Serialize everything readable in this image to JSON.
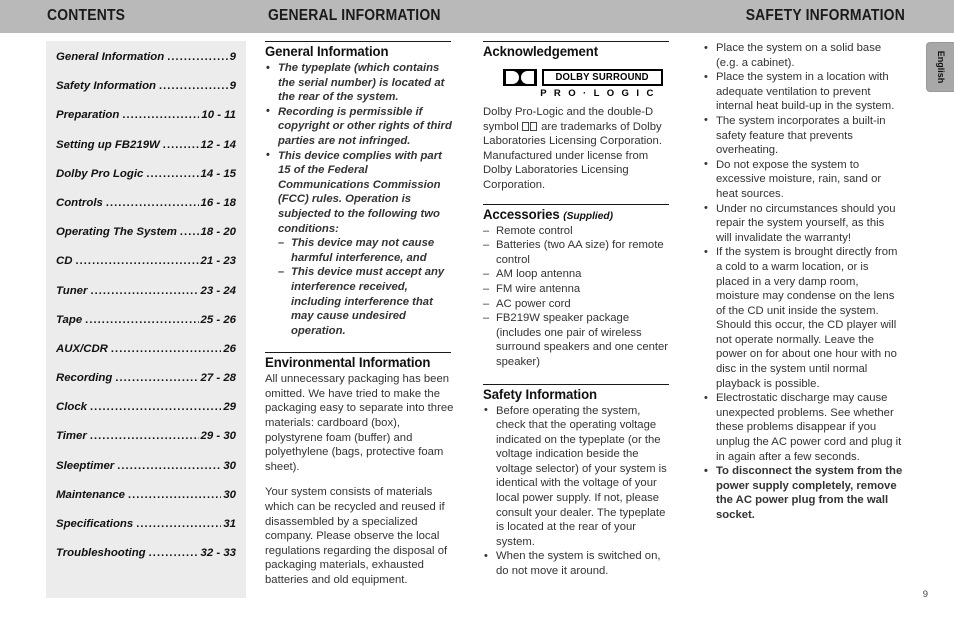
{
  "header": {
    "contents_title": "CONTENTS",
    "general_title": "GENERAL INFORMATION",
    "safety_title": "SAFETY INFORMATION"
  },
  "language_tab": {
    "label": "English"
  },
  "page_number": "9",
  "contents": {
    "entries": [
      {
        "label": "General Information",
        "page": "9"
      },
      {
        "label": "Safety Information",
        "page": "9"
      },
      {
        "label": "Preparation",
        "page": "10 - 11"
      },
      {
        "label": "Setting up FB219W",
        "page": "12 - 14"
      },
      {
        "label": "Dolby Pro Logic",
        "page": "14 - 15"
      },
      {
        "label": "Controls",
        "page": "16 - 18"
      },
      {
        "label": "Operating The System",
        "page": "18 - 20"
      },
      {
        "label": "CD",
        "page": "21 - 23"
      },
      {
        "label": "Tuner",
        "page": "23 - 24"
      },
      {
        "label": "Tape",
        "page": "25 - 26"
      },
      {
        "label": "AUX/CDR",
        "page": "26"
      },
      {
        "label": "Recording",
        "page": "27 - 28"
      },
      {
        "label": "Clock",
        "page": "29"
      },
      {
        "label": "Timer",
        "page": "29 - 30"
      },
      {
        "label": "Sleeptimer",
        "page": "30"
      },
      {
        "label": "Maintenance",
        "page": "30"
      },
      {
        "label": "Specifications",
        "page": "31"
      },
      {
        "label": "Troubleshooting",
        "page": "32 - 33"
      }
    ],
    "dot_leader": "......................................................................"
  },
  "general_information": {
    "heading": "General Information",
    "bullets": [
      "The typeplate (which contains the serial number) is located at the rear of the system.",
      "Recording is permissible if copyright or other rights of third parties are not infringed.",
      "This device complies with part 15 of the Federal Communications Commission (FCC) rules. Operation is subjected to the following two conditions:"
    ],
    "sub_conditions": [
      "This device may not cause harmful interference, and",
      "This device must accept any interference received, including interference that may cause undesired operation."
    ]
  },
  "environmental_information": {
    "heading": "Environmental Information",
    "paragraphs": [
      "All unnecessary packaging has been omitted. We have tried to make the packaging easy to separate into three materials: cardboard (box), polystyrene foam (buffer) and polyethylene (bags, protective foam sheet).",
      "Your system consists of materials which can be recycled and reused if disassembled by a specialized company. Please observe the local regulations regarding the disposal of packaging materials, exhausted batteries and old equipment."
    ]
  },
  "acknowledgement": {
    "heading": "Acknowledgement",
    "logo": {
      "brand_text": "DOLBY SURROUND",
      "sub_text": "P R O  ·  L O G I C"
    },
    "paragraph_1_part_1": "Dolby Pro-Logic and the double-D symbol",
    "paragraph_1_part_2": "are trademarks of Dolby Laboratories Licensing Corporation.",
    "paragraph_2": "Manufactured under license from Dolby Laboratories Licensing Corporation."
  },
  "accessories": {
    "heading": "Accessories",
    "heading_suffix": "(Supplied)",
    "items": [
      "Remote control",
      "Batteries (two AA size) for remote control",
      "AM loop antenna",
      "FM wire antenna",
      "AC power cord",
      "FB219W speaker package (includes one pair of wireless surround speakers and one center speaker)"
    ]
  },
  "safety_information": {
    "heading": "Safety Information",
    "bullets_left": [
      "Before operating the system, check that the operating voltage indicated on the typeplate (or the voltage indication beside the voltage selector) of your system is identical with the voltage of your local power supply. If not, please consult your dealer. The typeplate is located at the rear of your system.",
      "When the system is switched on, do not move it around."
    ],
    "bullets_right": [
      "Place the system on a solid base (e.g. a cabinet).",
      "Place the system in a location with adequate ventilation to prevent internal heat build-up in the system.",
      "The system incorporates a built-in safety feature that prevents overheating.",
      "Do not expose the system to excessive moisture, rain, sand or heat sources.",
      "Under no circumstances should you repair the system yourself, as this will invalidate the warranty!",
      "If the system is brought directly from a cold to a warm location, or is placed in a very damp room, moisture may condense on the lens of the CD unit inside the system. Should this occur, the CD player will not operate normally. Leave the power on for about one hour with no disc in the system until normal playback is possible.",
      "Electrostatic discharge may cause unexpected problems. See whether these problems disappear if you unplug the AC power cord and plug it in again after a few seconds."
    ],
    "bullet_bold": "To disconnect the system from the power supply completely, remove the AC power plug from the wall socket."
  }
}
